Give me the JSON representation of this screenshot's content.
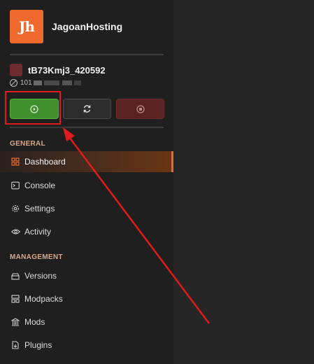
{
  "brand": {
    "logo_text": "Jh",
    "name": "JagoanHosting"
  },
  "server": {
    "name": "tB73Kmj3_420592",
    "ip_prefix": "101"
  },
  "power_buttons": {
    "start": "play-icon",
    "restart": "refresh-icon",
    "stop": "stop-icon"
  },
  "sections": {
    "general": "GENERAL",
    "management": "MANAGEMENT"
  },
  "nav": {
    "general": [
      {
        "label": "Dashboard",
        "icon": "dashboard-icon",
        "active": true
      },
      {
        "label": "Console",
        "icon": "terminal-icon"
      },
      {
        "label": "Settings",
        "icon": "gear-icon"
      },
      {
        "label": "Activity",
        "icon": "eye-icon"
      }
    ],
    "management": [
      {
        "label": "Versions",
        "icon": "layers-icon"
      },
      {
        "label": "Modpacks",
        "icon": "package-icon"
      },
      {
        "label": "Mods",
        "icon": "building-icon"
      },
      {
        "label": "Plugins",
        "icon": "plugin-file-icon"
      }
    ]
  },
  "colors": {
    "accent": "#e8692b",
    "start_green": "#3f8f2c",
    "stop_red": "#5b2222",
    "annotation_red": "#e01b1b"
  }
}
